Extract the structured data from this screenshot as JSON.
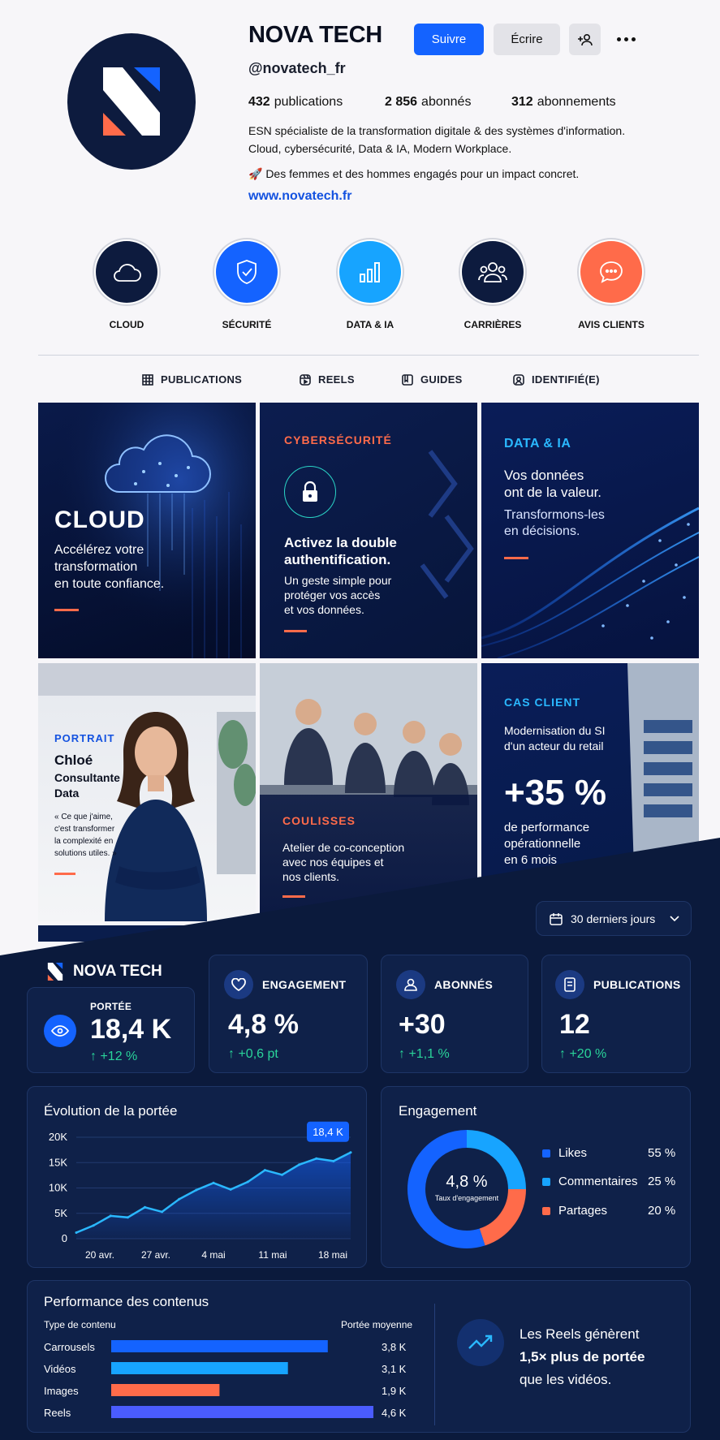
{
  "profile": {
    "name": "NOVA TECH",
    "handle": "@novatech_fr",
    "follow_label": "Suivre",
    "write_label": "Écrire",
    "stats": [
      {
        "value": "432",
        "label": "publications"
      },
      {
        "value": "2 856",
        "label": "abonnés"
      },
      {
        "value": "312",
        "label": "abonnements"
      }
    ],
    "bio_line1": "ESN spécialiste de la transformation digitale & des systèmes d'information.",
    "bio_line2": "Cloud, cybersécurité, Data & IA, Modern Workplace.",
    "bio_line3": "🚀 Des femmes et des hommes engagés pour un impact concret.",
    "website": "www.novatech.fr"
  },
  "highlights": [
    {
      "label": "CLOUD",
      "icon": "cloud-icon",
      "color": "#0d1b3e"
    },
    {
      "label": "SÉCURITÉ",
      "icon": "shield-icon",
      "color": "#1463ff"
    },
    {
      "label": "DATA & IA",
      "icon": "bar-chart-icon",
      "color": "#17a4ff"
    },
    {
      "label": "CARRIÈRES",
      "icon": "users-icon",
      "color": "#0d1b3e"
    },
    {
      "label": "AVIS CLIENTS",
      "icon": "chat-bubble-icon",
      "color": "#ff6b4a"
    }
  ],
  "tabs": [
    {
      "label": "PUBLICATIONS",
      "icon": "grid-icon"
    },
    {
      "label": "REELS",
      "icon": "reels-icon"
    },
    {
      "label": "GUIDES",
      "icon": "guides-icon"
    },
    {
      "label": "IDENTIFIÉ(E)",
      "icon": "tagged-icon"
    }
  ],
  "posts": {
    "cloud": {
      "title": "CLOUD",
      "l1": "Accélérez votre",
      "l2": "transformation",
      "l3": "en toute confiance."
    },
    "cyber": {
      "kicker": "CYBERSÉCURITÉ",
      "h1": "Activez la double",
      "h2": "authentification.",
      "b1": "Un geste simple pour",
      "b2": "protéger vos accès",
      "b3": "et vos données."
    },
    "data": {
      "kicker": "DATA & IA",
      "h1": "Vos données",
      "h2": "ont de la valeur.",
      "b1": "Transformons-les",
      "b2": "en décisions."
    },
    "portrait": {
      "kicker": "PORTRAIT",
      "name": "Chloé",
      "r1": "Consultante",
      "r2": "Data",
      "q1": "« Ce que j'aime,",
      "q2": "c'est transformer",
      "q3": "la complexité en",
      "q4": "solutions utiles. »"
    },
    "coulisses": {
      "kicker": "COULISSES",
      "b1": "Atelier de co-conception",
      "b2": "avec nos équipes et",
      "b3": "nos clients."
    },
    "cas": {
      "kicker": "CAS CLIENT",
      "h1": "Modernisation du SI",
      "h2": "d'un acteur du retail",
      "big": "+35 %",
      "b1": "de performance",
      "b2": "opérationnelle",
      "b3": "en 6 mois"
    }
  },
  "dashboard": {
    "brand": "NOVA TECH",
    "period": "30 derniers jours",
    "kpis": [
      {
        "title": "PORTÉE",
        "value": "18,4 K",
        "delta": "↑ +12 %",
        "icon": "eye-icon"
      },
      {
        "title": "ENGAGEMENT",
        "value": "4,8 %",
        "delta": "↑ +0,6 pt",
        "icon": "heart-icon"
      },
      {
        "title": "ABONNÉS",
        "value": "+30",
        "delta": "↑ +1,1 %",
        "icon": "users-icon"
      },
      {
        "title": "PUBLICATIONS",
        "value": "12",
        "delta": "↑ +20 %",
        "icon": "document-icon"
      }
    ],
    "reach_title": "Évolution de la portée",
    "engagement_title": "Engagement",
    "engagement_center": "4,8 %",
    "engagement_center_sub": "Taux d'engagement",
    "perf_title": "Performance des contenus",
    "perf_col1": "Type de contenu",
    "perf_col2": "Portée moyenne",
    "insight_l1": "Les Reels génèrent",
    "insight_l2": "1,5× plus de portée",
    "insight_l3": "que les vidéos.",
    "colors": {
      "accent": "#1463ff",
      "cyan": "#17a4ff",
      "coral": "#ff6b4a",
      "green": "#2ad49a",
      "violet": "#4a5cff"
    }
  },
  "chart_data": [
    {
      "type": "area",
      "title": "Évolution de la portée",
      "x_ticks": [
        "20 avr.",
        "27 avr.",
        "4 mai",
        "11 mai",
        "18 mai"
      ],
      "y_ticks": [
        "0",
        "5K",
        "10K",
        "15K",
        "20K"
      ],
      "ylim": [
        0,
        20000
      ],
      "values": [
        1200,
        2600,
        4500,
        4200,
        6200,
        5300,
        7800,
        9600,
        11000,
        9700,
        11200,
        13500,
        12600,
        14600,
        15800,
        15300,
        17000
      ],
      "end_label": "18,4 K"
    },
    {
      "type": "pie",
      "title": "Engagement",
      "labels": [
        "Likes",
        "Commentaires",
        "Partages"
      ],
      "values": [
        55,
        25,
        20
      ],
      "display": [
        "55 %",
        "25 %",
        "20 %"
      ],
      "colors": [
        "#1463ff",
        "#17a4ff",
        "#ff6b4a"
      ]
    },
    {
      "type": "bar",
      "title": "Performance des contenus",
      "categories": [
        "Carrousels",
        "Vidéos",
        "Images",
        "Reels"
      ],
      "values": [
        3.8,
        3.1,
        1.9,
        4.6
      ],
      "display": [
        "3,8 K",
        "3,1 K",
        "1,9 K",
        "4,6 K"
      ],
      "colors": [
        "#1463ff",
        "#17a4ff",
        "#ff6b4a",
        "#4a5cff"
      ]
    }
  ]
}
